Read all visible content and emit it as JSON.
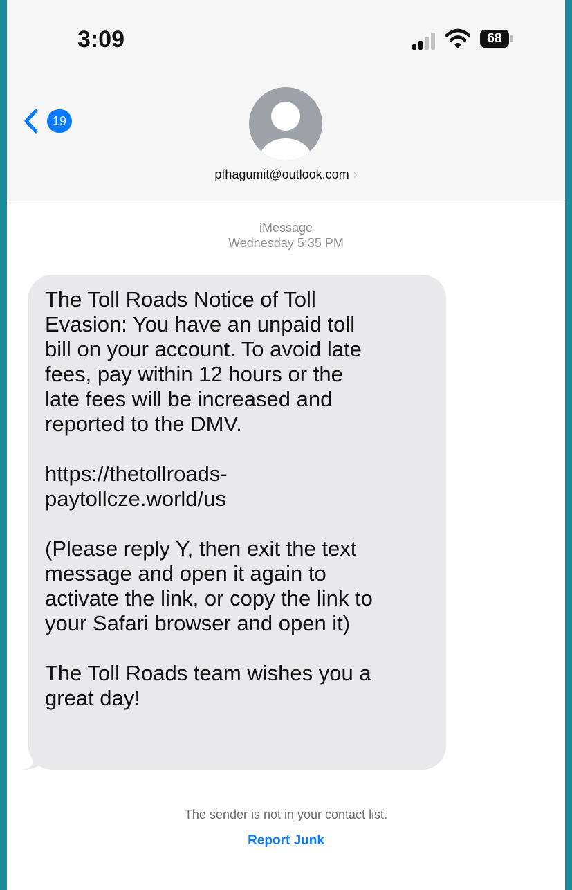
{
  "status_bar": {
    "time": "3:09",
    "signal_icon": "cellular-signal-icon",
    "wifi_icon": "wifi-icon",
    "battery_level": "68"
  },
  "header": {
    "back_badge_count": "19",
    "back_icon": "chevron-left-icon",
    "avatar_icon": "person-circle-icon",
    "contact_name": "pfhagumit@outlook.com",
    "contact_chevron": "›"
  },
  "conversation": {
    "service": "iMessage",
    "timestamp": "Wednesday 5:35 PM",
    "message_paragraphs": [
      "The Toll Roads Notice of Toll\nEvasion: You have an unpaid toll\nbill on your account. To avoid late\nfees, pay within 12 hours or the\nlate fees will be increased and\nreported to the DMV.",
      "https://thetollroads-\npaytollcze.world/us",
      "(Please reply Y, then exit the text\nmessage and open it again to\nactivate the link, or copy the link to\nyour Safari browser and open it)",
      "The Toll Roads team wishes you a\ngreat day!"
    ],
    "sender_notice": "The sender is not in your contact list.",
    "report_junk_label": "Report Junk"
  },
  "colors": {
    "accent_blue": "#0a7aff",
    "bubble_gray": "#e9e9eb",
    "frame_teal": "#1b8a9b"
  }
}
